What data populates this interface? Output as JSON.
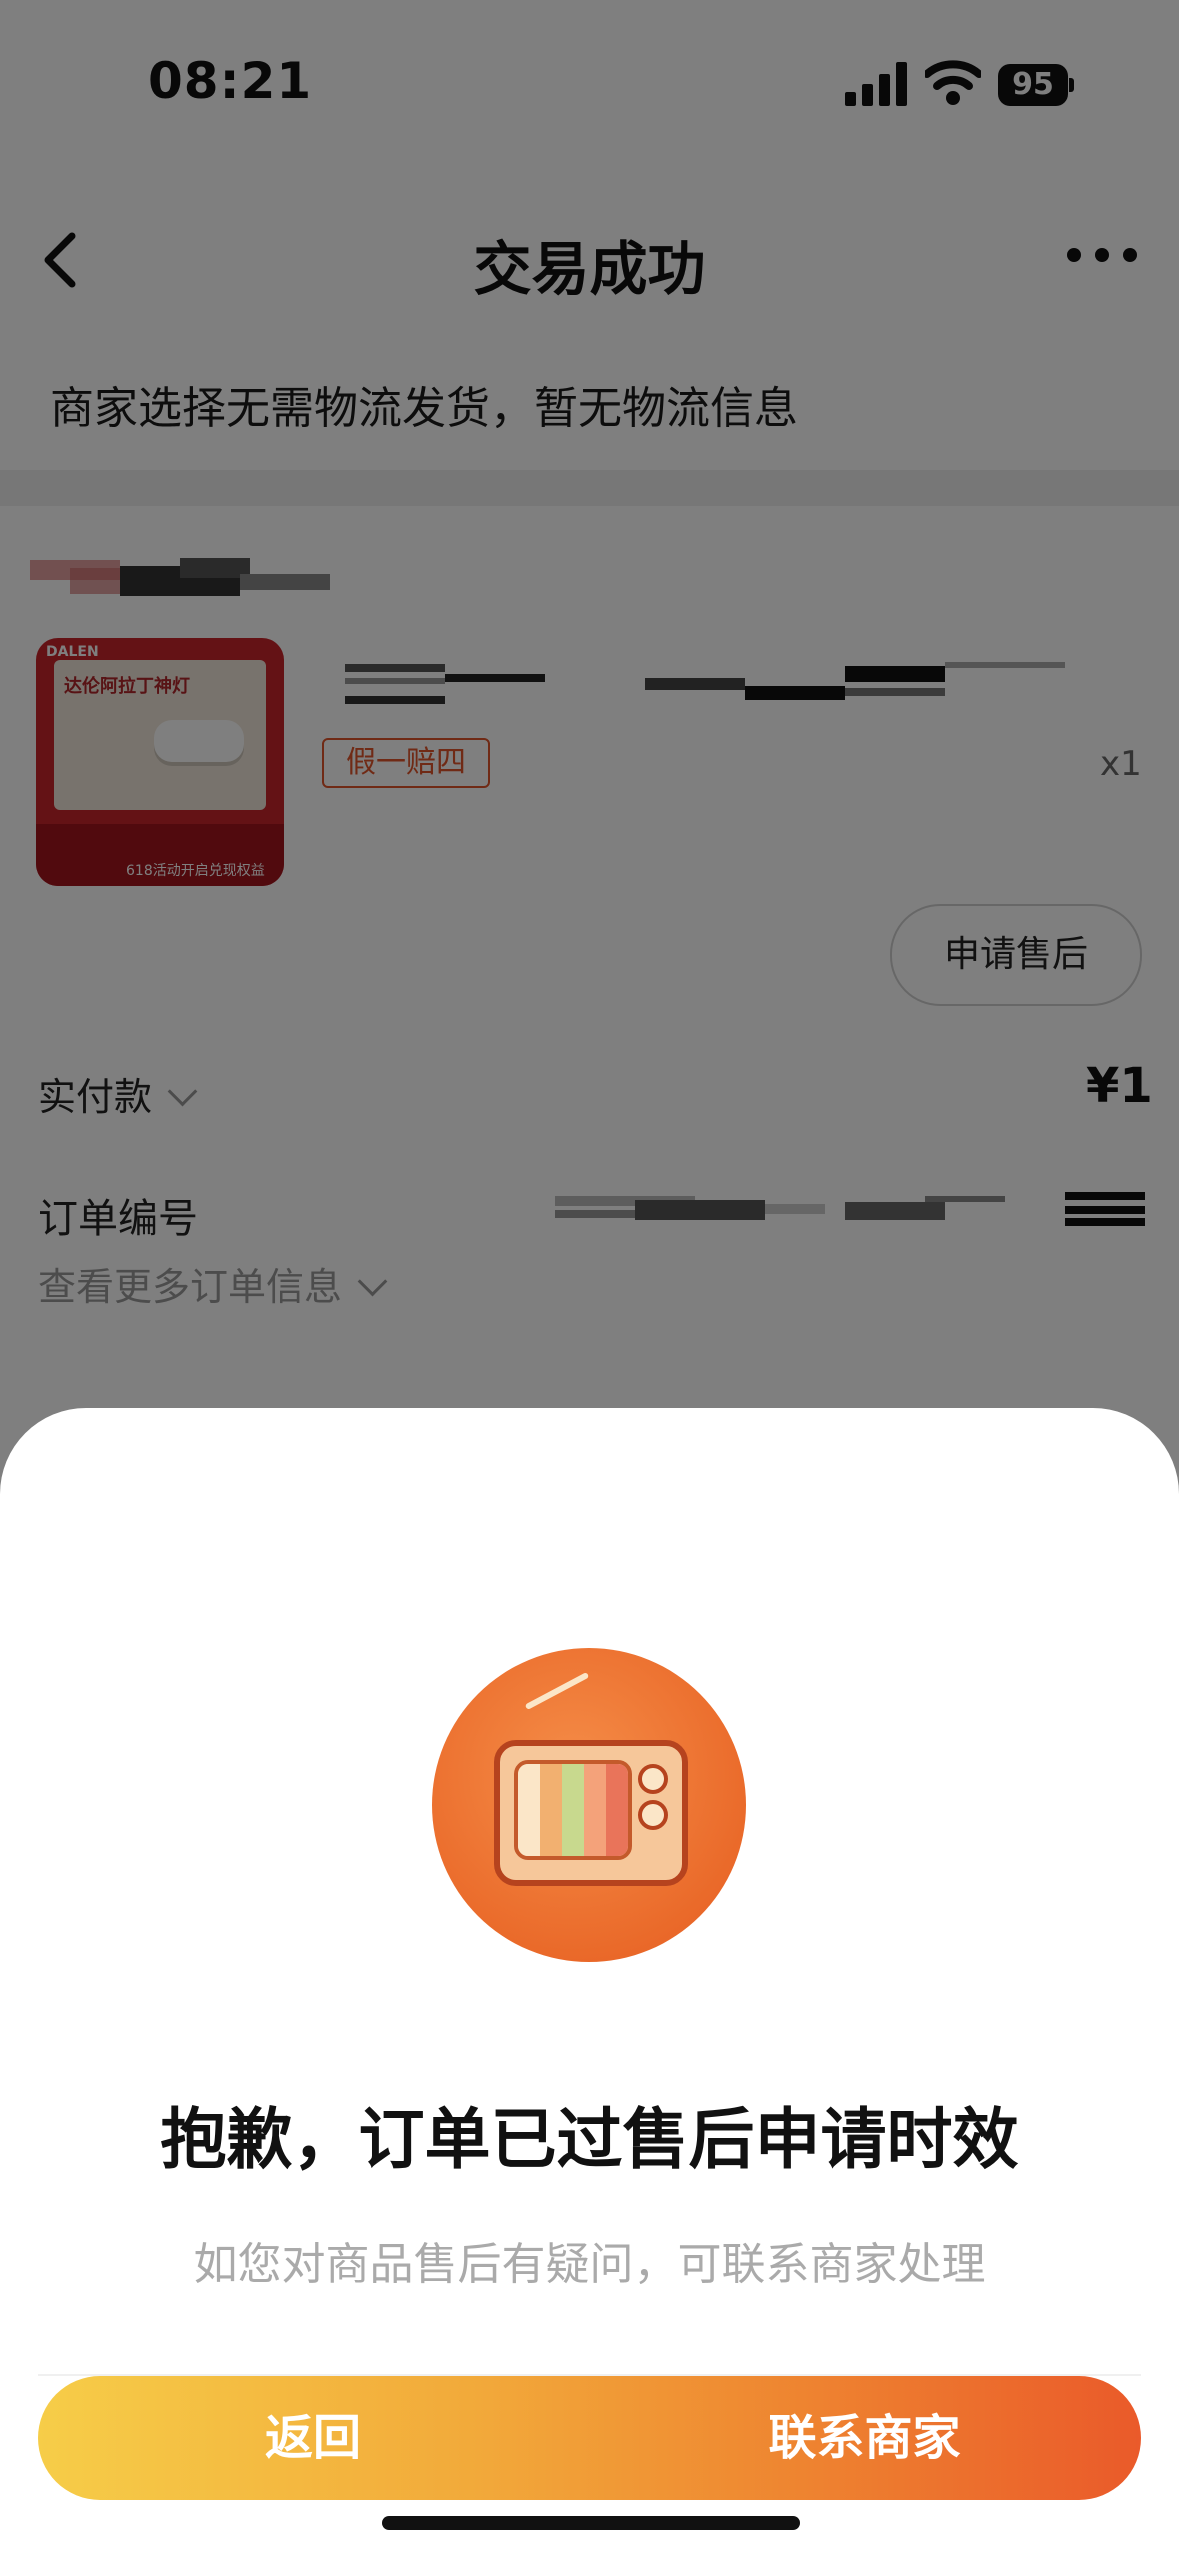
{
  "status_bar": {
    "time": "08:21",
    "battery": "95"
  },
  "nav": {
    "title": "交易成功"
  },
  "logistics_notice": "商家选择无需物流发货，暂无物流信息",
  "order": {
    "badge": "假一赔四",
    "quantity": "x1",
    "aftersale_button": "申请售后",
    "paid_label": "实付款",
    "paid_value": "¥1",
    "order_number_label": "订单编号",
    "more_info": "查看更多订单信息",
    "product_image": {
      "brand": "DALEN",
      "headline": "达伦阿拉丁神灯",
      "campaign": "618活动开启兑现权益"
    }
  },
  "modal": {
    "title": "抱歉，订单已过售后申请时效",
    "subtitle": "如您对商品售后有疑问，可联系商家处理",
    "back_button": "返回",
    "contact_button": "联系商家",
    "icon": "retro-tv-icon"
  },
  "colors": {
    "accent_start": "#f6cd48",
    "accent_end": "#ea5a2a",
    "badge": "#e0552b"
  }
}
